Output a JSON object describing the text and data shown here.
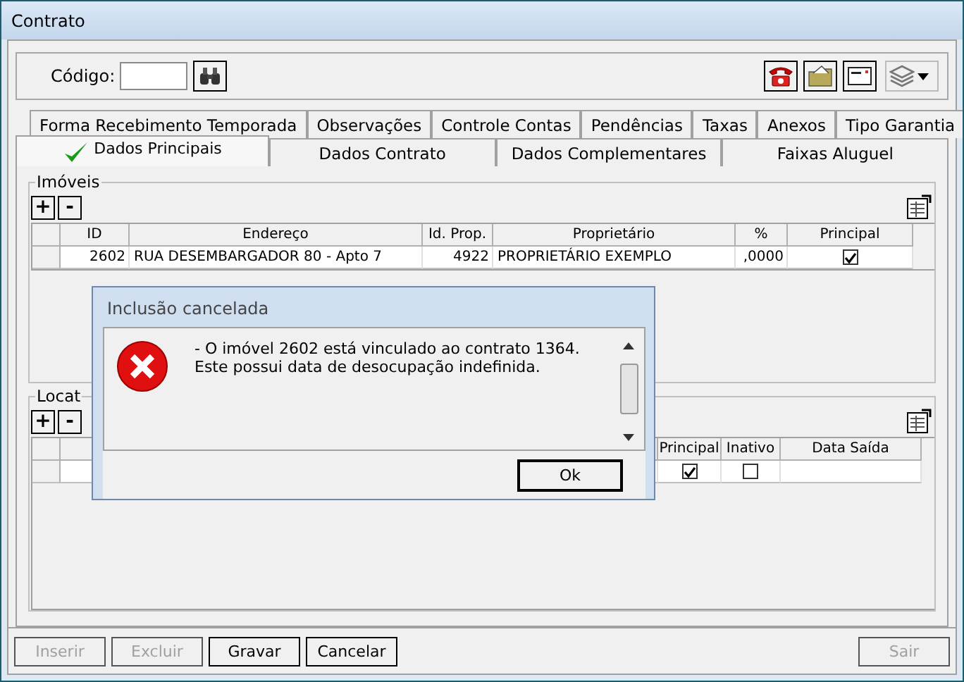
{
  "window": {
    "title": "Contrato"
  },
  "toolbar": {
    "code_label": "Código:"
  },
  "tab_rows": [
    [
      {
        "label": "Forma Recebimento Temporada",
        "selected": false
      },
      {
        "label": "Observações",
        "selected": false
      },
      {
        "label": "Controle Contas",
        "selected": false
      },
      {
        "label": "Pendências",
        "selected": false
      },
      {
        "label": "Taxas",
        "selected": false
      },
      {
        "label": "Anexos",
        "selected": false
      },
      {
        "label": "Tipo Garantia",
        "selected": false
      }
    ],
    [
      {
        "label": "Dados Principais",
        "selected": true
      },
      {
        "label": "Dados Contrato",
        "selected": false
      },
      {
        "label": "Dados Complementares",
        "selected": false
      },
      {
        "label": "Faixas Aluguel",
        "selected": false
      }
    ]
  ],
  "imoveis": {
    "title": "Imóveis",
    "add": "+",
    "remove": "-",
    "columns": [
      "ID",
      "Endereço",
      "Id. Prop.",
      "Proprietário",
      "%",
      "Principal"
    ],
    "rows": [
      {
        "cells": [
          "2602",
          "RUA DESEMBARGADOR 80 - Apto 7",
          "4922",
          "PROPRIETÁRIO EXEMPLO",
          ",0000"
        ],
        "principal": true
      }
    ]
  },
  "locatarios": {
    "title": "Locat",
    "add": "+",
    "remove": "-",
    "columns": [
      "Principal",
      "Inativo",
      "Data Saída"
    ],
    "rows": [
      {
        "principal": true,
        "inativo": false,
        "data_saida": ""
      }
    ]
  },
  "dialog": {
    "title": "Inclusão cancelada",
    "lines": [
      "- O imóvel 2602 está vinculado ao contrato 1364.",
      "Este possui data de desocupação indefinida."
    ],
    "button": "Ok"
  },
  "buttons": [
    {
      "label": "Inserir",
      "disabled": true
    },
    {
      "label": "Excluir",
      "disabled": true
    },
    {
      "label": "Gravar",
      "disabled": false
    },
    {
      "label": "Cancelar",
      "disabled": false
    },
    {
      "label": "Sair",
      "disabled": true
    }
  ]
}
